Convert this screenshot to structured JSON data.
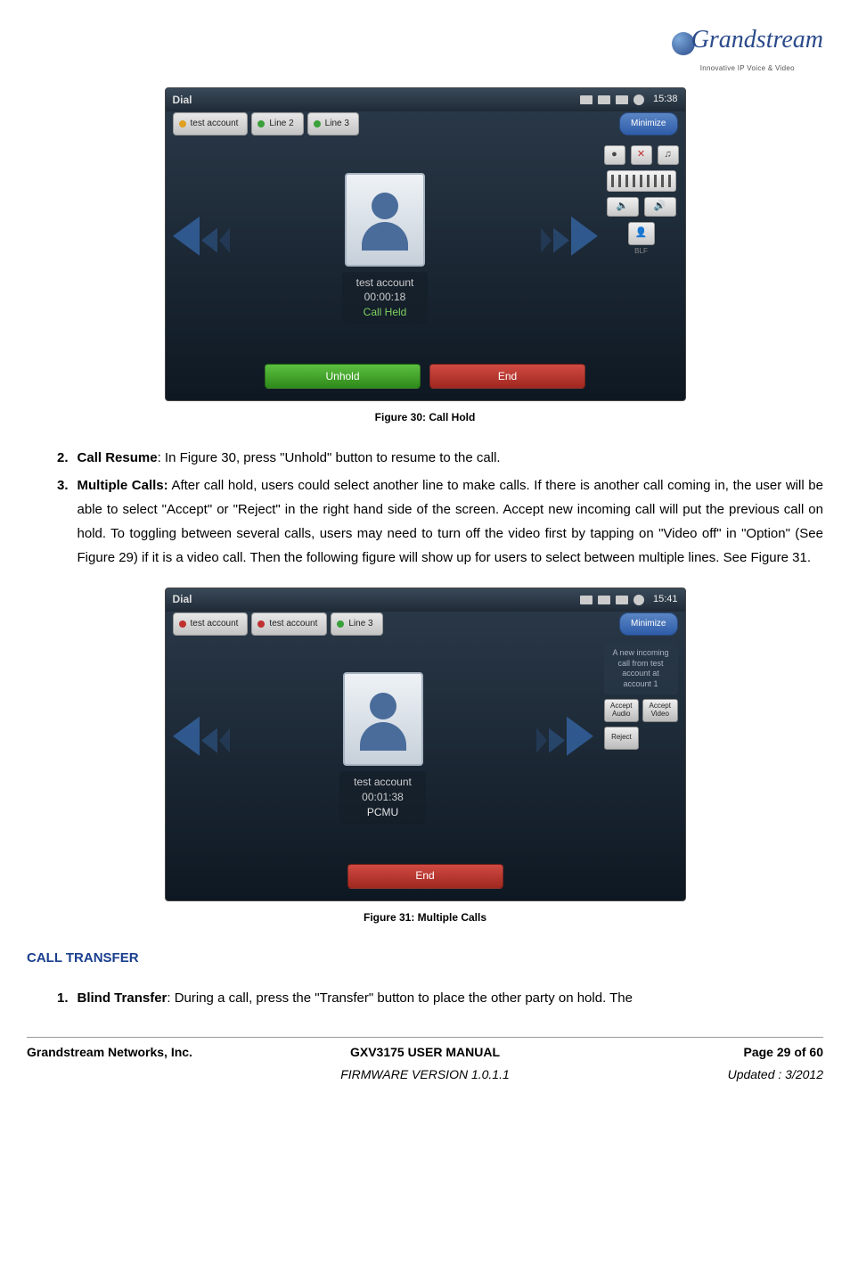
{
  "logo": {
    "brand": "Grandstream",
    "tagline": "Innovative IP Voice & Video"
  },
  "fig30": {
    "caption": "Figure 30: Call Hold",
    "screen": {
      "title": "Dial",
      "clock": "15:38",
      "tabs": [
        {
          "label": "test account",
          "color": "orange"
        },
        {
          "label": "Line 2",
          "color": "green"
        },
        {
          "label": "Line 3",
          "color": "green"
        }
      ],
      "minimize": "Minimize",
      "caller_name": "test account",
      "call_time": "00:00:18",
      "call_status": "Call Held",
      "btn_left": "Unhold",
      "btn_right": "End",
      "blf_label": "BLF"
    }
  },
  "list": {
    "item2_label": "2.",
    "item2_bold": "Call Resume",
    "item2_text": ": In Figure 30, press \"Unhold\" button to resume to the call.",
    "item3_label": "3.",
    "item3_bold": "Multiple Calls:",
    "item3_text": " After call hold, users could select another line to make calls. If there is another call coming in, the user will be able to select \"Accept\" or \"Reject\" in the right hand side of the screen. Accept new incoming call will put the previous call on hold. To toggling between several calls, users may need to turn off the video first by tapping on \"Video off\" in \"Option\" (See Figure 29) if it is a video call. Then the following figure will show up for users to select between multiple lines. See Figure 31."
  },
  "fig31": {
    "caption": "Figure 31: Multiple Calls",
    "screen": {
      "title": "Dial",
      "clock": "15:41",
      "tabs": [
        {
          "label": "test account",
          "color": "red"
        },
        {
          "label": "test account",
          "color": "red"
        },
        {
          "label": "Line 3",
          "color": "green"
        }
      ],
      "minimize": "Minimize",
      "caller_name": "test account",
      "call_time": "00:01:38",
      "call_status": "PCMU",
      "incoming_msg": "A new incoming call from test account at account 1",
      "accept_audio": "Accept Audio",
      "accept_video": "Accept Video",
      "reject": "Reject",
      "btn_end": "End"
    }
  },
  "section_heading": "CALL TRANSFER",
  "transfer": {
    "item1_label": "1.",
    "item1_bold": "Blind Transfer",
    "item1_text": ": During a call, press the \"Transfer\" button to place the other party on hold. The"
  },
  "footer": {
    "company": "Grandstream Networks, Inc.",
    "manual": "GXV3175 USER MANUAL",
    "page": "Page 29 of 60",
    "firmware": "FIRMWARE VERSION 1.0.1.1",
    "updated": "Updated : 3/2012"
  }
}
